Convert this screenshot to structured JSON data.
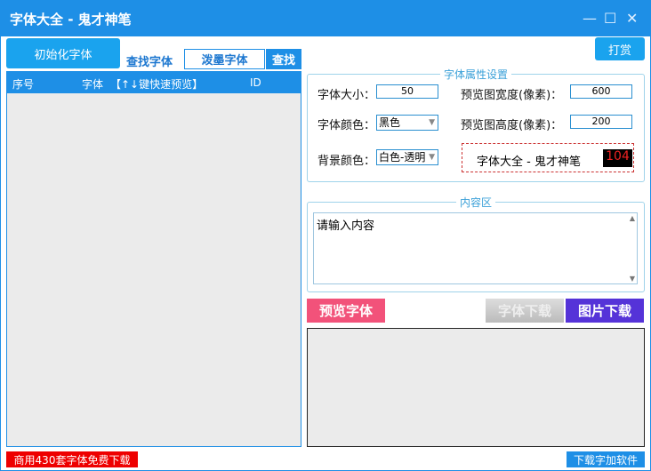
{
  "title": "字体大全 - 鬼才神笔",
  "toolbar": {
    "init": "初始化字体",
    "find_label": "查找字体",
    "search_value": "泼墨字体",
    "find_btn": "查找",
    "reward": "打赏"
  },
  "grid": {
    "columns": [
      "序号",
      "字体",
      "【↑↓键快速预览】",
      "ID"
    ]
  },
  "props": {
    "legend": "字体属性设置",
    "size_label": "字体大小：",
    "size": "50",
    "width_label": "预览图宽度(像素)：",
    "width": "600",
    "color_label": "字体颜色：",
    "color": "黑色",
    "height_label": "预览图高度(像素)：",
    "height": "200",
    "bg_label": "背景颜色：",
    "bg": "白色-透明",
    "sample": "字体大全 - 鬼才神笔",
    "sample_num": "104"
  },
  "content": {
    "legend": "内容区",
    "text": "请输入内容"
  },
  "actions": {
    "preview": "预览字体",
    "font_download": "字体下载",
    "image_download": "图片下载"
  },
  "footer": {
    "promo": "商用430套字体免费下载",
    "download": "下载字加软件"
  }
}
